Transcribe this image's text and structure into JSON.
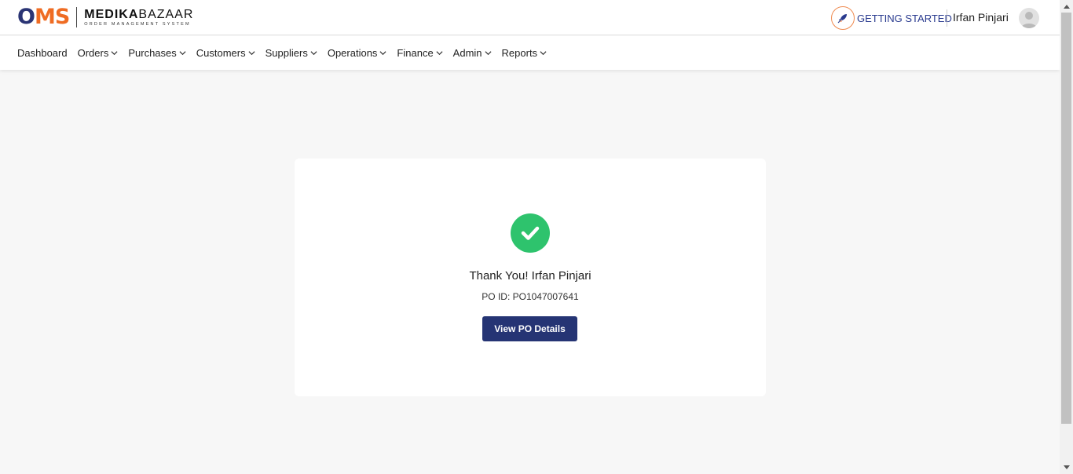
{
  "header": {
    "logo_oms_o": "O",
    "logo_oms_ms": "MS",
    "logo_brand_bold": "MEDIKA",
    "logo_brand_rest": "BAZAAR",
    "logo_subtitle": "ORDER MANAGEMENT SYSTEM",
    "getting_started": "GETTING STARTED",
    "user_name": "Irfan Pinjari"
  },
  "nav": {
    "items": [
      {
        "label": "Dashboard",
        "dropdown": false
      },
      {
        "label": "Orders",
        "dropdown": true
      },
      {
        "label": "Purchases",
        "dropdown": true
      },
      {
        "label": "Customers",
        "dropdown": true
      },
      {
        "label": "Suppliers",
        "dropdown": true
      },
      {
        "label": "Operations",
        "dropdown": true
      },
      {
        "label": "Finance",
        "dropdown": true
      },
      {
        "label": "Admin",
        "dropdown": true
      },
      {
        "label": "Reports",
        "dropdown": true
      }
    ]
  },
  "confirmation": {
    "icon": "check-circle-icon",
    "thanks_text": "Thank You! Irfan Pinjari",
    "po_id_text": "PO ID: PO1047007641",
    "button_label": "View PO Details"
  },
  "colors": {
    "brand_navy": "#253474",
    "brand_orange": "#ef6c23",
    "success_green": "#2ec36d",
    "page_bg": "#f7f7f7"
  }
}
